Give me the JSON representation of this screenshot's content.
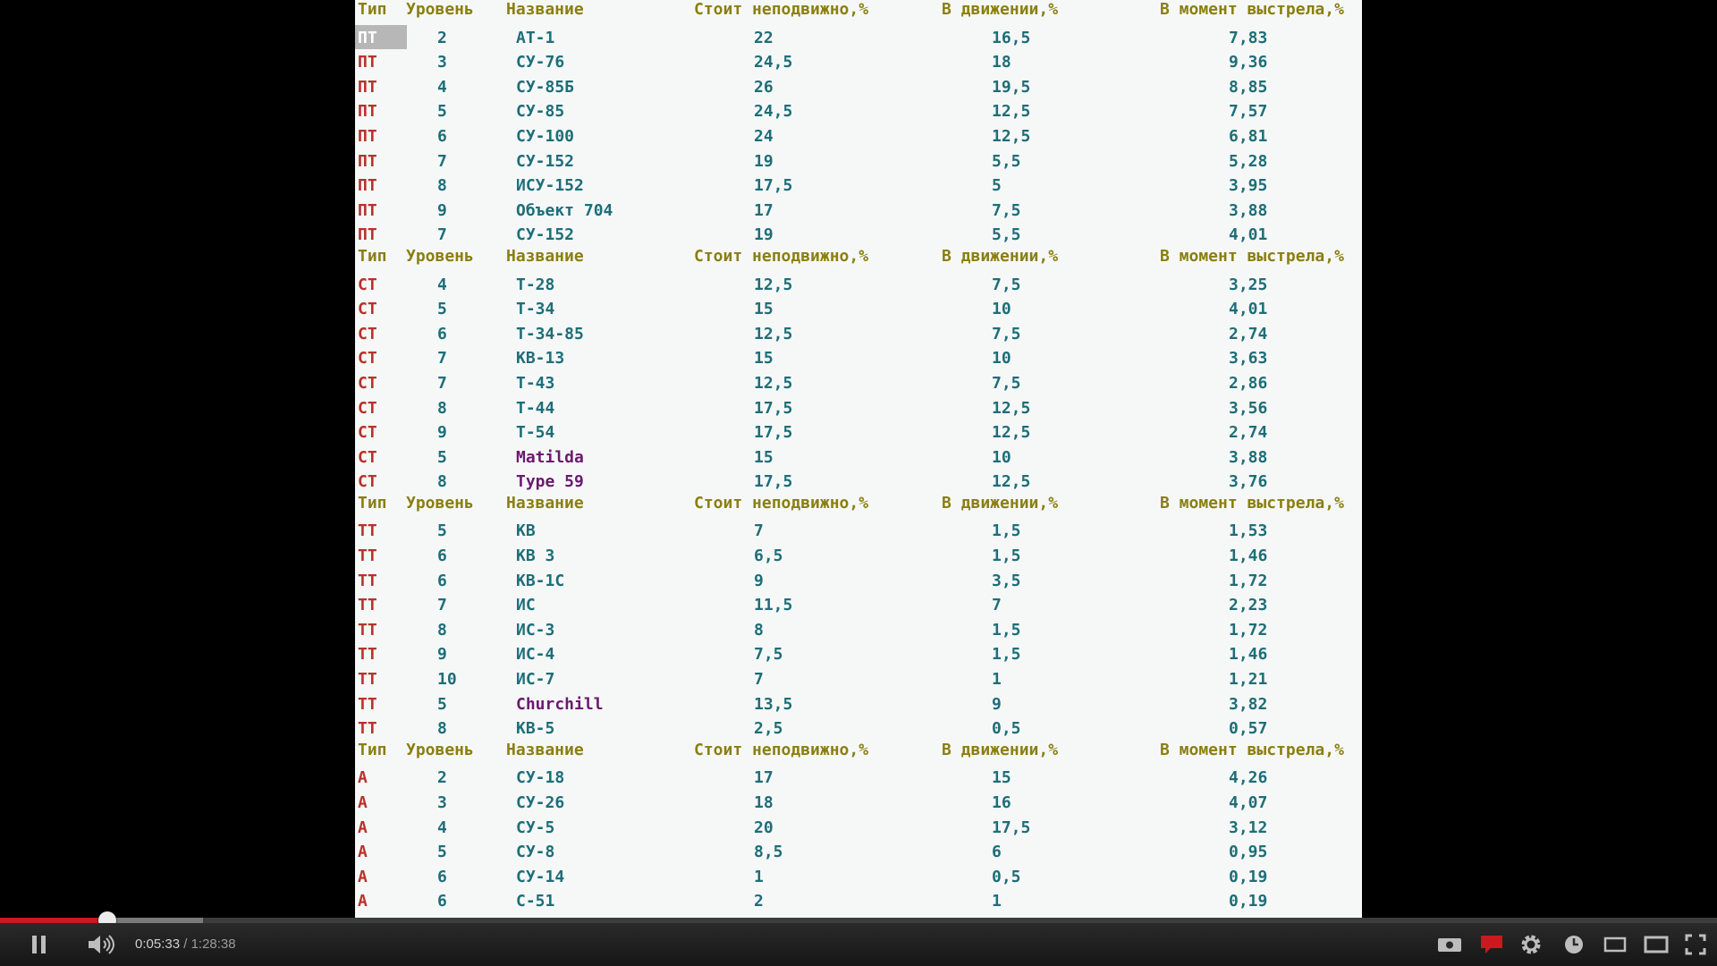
{
  "player": {
    "current_time": "0:05:33",
    "separator": " / ",
    "duration": "1:28:38",
    "played_fraction": 0.0626,
    "loaded_fraction": 0.118
  },
  "table": {
    "headers": [
      "Тип",
      "Уровень",
      "Название",
      "Стоит неподвижно,%",
      "В движении,%",
      "В момент выстрела,%"
    ],
    "groups": [
      {
        "rows": [
          {
            "type": "ПТ",
            "level": "2",
            "name": "АТ-1",
            "still": "22",
            "move": "16,5",
            "shot": "7,83"
          },
          {
            "type": "ПТ",
            "level": "3",
            "name": "СУ-76",
            "still": "24,5",
            "move": "18",
            "shot": "9,36"
          },
          {
            "type": "ПТ",
            "level": "4",
            "name": "СУ-85Б",
            "still": "26",
            "move": "19,5",
            "shot": "8,85"
          },
          {
            "type": "ПТ",
            "level": "5",
            "name": "СУ-85",
            "still": "24,5",
            "move": "12,5",
            "shot": "7,57"
          },
          {
            "type": "ПТ",
            "level": "6",
            "name": "СУ-100",
            "still": "24",
            "move": "12,5",
            "shot": "6,81"
          },
          {
            "type": "ПТ",
            "level": "7",
            "name": "СУ-152",
            "still": "19",
            "move": "5,5",
            "shot": "5,28"
          },
          {
            "type": "ПТ",
            "level": "8",
            "name": "ИСУ-152",
            "still": "17,5",
            "move": "5",
            "shot": "3,95"
          },
          {
            "type": "ПТ",
            "level": "9",
            "name": "Объект 704",
            "still": "17",
            "move": "7,5",
            "shot": "3,88"
          },
          {
            "type": "ПТ",
            "level": "7",
            "name": "СУ-152",
            "still": "19",
            "move": "5,5",
            "shot": "4,01"
          }
        ]
      },
      {
        "rows": [
          {
            "type": "СТ",
            "level": "4",
            "name": "Т-28",
            "still": "12,5",
            "move": "7,5",
            "shot": "3,25"
          },
          {
            "type": "СТ",
            "level": "5",
            "name": "Т-34",
            "still": "15",
            "move": "10",
            "shot": "4,01"
          },
          {
            "type": "СТ",
            "level": "6",
            "name": "Т-34-85",
            "still": "12,5",
            "move": "7,5",
            "shot": "2,74"
          },
          {
            "type": "СТ",
            "level": "7",
            "name": "КВ-13",
            "still": "15",
            "move": "10",
            "shot": "3,63"
          },
          {
            "type": "СТ",
            "level": "7",
            "name": "Т-43",
            "still": "12,5",
            "move": "7,5",
            "shot": "2,86"
          },
          {
            "type": "СТ",
            "level": "8",
            "name": "Т-44",
            "still": "17,5",
            "move": "12,5",
            "shot": "3,56"
          },
          {
            "type": "СТ",
            "level": "9",
            "name": "Т-54",
            "still": "17,5",
            "move": "12,5",
            "shot": "2,74"
          },
          {
            "type": "СТ",
            "level": "5",
            "name": "Matilda",
            "still": "15",
            "move": "10",
            "shot": "3,88",
            "foreign": true
          },
          {
            "type": "СТ",
            "level": "8",
            "name": "Type 59",
            "still": "17,5",
            "move": "12,5",
            "shot": "3,76",
            "foreign": true
          }
        ]
      },
      {
        "rows": [
          {
            "type": "ТТ",
            "level": "5",
            "name": "КВ",
            "still": "7",
            "move": "1,5",
            "shot": "1,53"
          },
          {
            "type": "ТТ",
            "level": "6",
            "name": "КВ 3",
            "still": "6,5",
            "move": "1,5",
            "shot": "1,46"
          },
          {
            "type": "ТТ",
            "level": "6",
            "name": "КВ-1С",
            "still": "9",
            "move": "3,5",
            "shot": "1,72"
          },
          {
            "type": "ТТ",
            "level": "7",
            "name": "ИС",
            "still": "11,5",
            "move": "7",
            "shot": "2,23"
          },
          {
            "type": "ТТ",
            "level": "8",
            "name": "ИС-3",
            "still": "8",
            "move": "1,5",
            "shot": "1,72"
          },
          {
            "type": "ТТ",
            "level": "9",
            "name": "ИС-4",
            "still": "7,5",
            "move": "1,5",
            "shot": "1,46"
          },
          {
            "type": "ТТ",
            "level": "10",
            "name": "ИС-7",
            "still": "7",
            "move": "1",
            "shot": "1,21"
          },
          {
            "type": "ТТ",
            "level": "5",
            "name": "Churchill",
            "still": "13,5",
            "move": "9",
            "shot": "3,82",
            "foreign": true
          },
          {
            "type": "ТТ",
            "level": "8",
            "name": "КВ-5",
            "still": "2,5",
            "move": "0,5",
            "shot": "0,57"
          }
        ]
      },
      {
        "rows": [
          {
            "type": "А",
            "level": "2",
            "name": "СУ-18",
            "still": "17",
            "move": "15",
            "shot": "4,26"
          },
          {
            "type": "А",
            "level": "3",
            "name": "СУ-26",
            "still": "18",
            "move": "16",
            "shot": "4,07"
          },
          {
            "type": "А",
            "level": "4",
            "name": "СУ-5",
            "still": "20",
            "move": "17,5",
            "shot": "3,12"
          },
          {
            "type": "А",
            "level": "5",
            "name": "СУ-8",
            "still": "8,5",
            "move": "6",
            "shot": "0,95"
          },
          {
            "type": "А",
            "level": "6",
            "name": "СУ-14",
            "still": "1",
            "move": "0,5",
            "shot": "0,19"
          },
          {
            "type": "А",
            "level": "6",
            "name": "С-51",
            "still": "2",
            "move": "1",
            "shot": "0,19"
          }
        ]
      }
    ]
  }
}
